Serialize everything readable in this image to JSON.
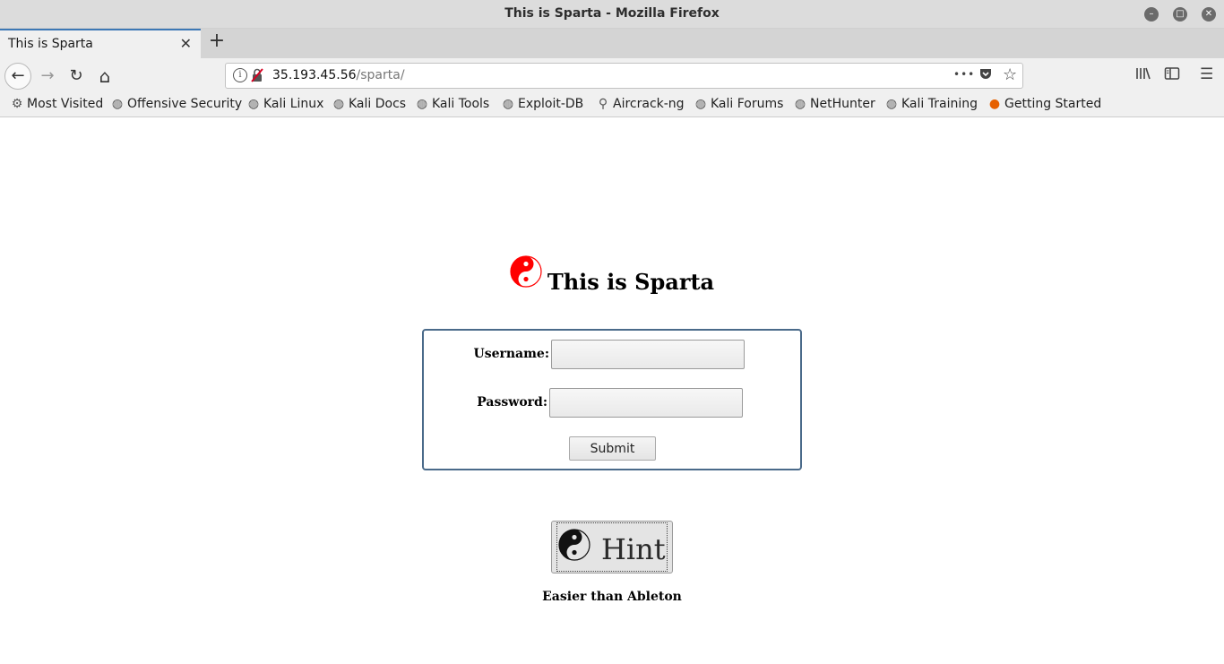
{
  "window": {
    "title": "This is Sparta - Mozilla Firefox"
  },
  "tab": {
    "title": "This is Sparta",
    "close_glyph": "✕",
    "new_tab_glyph": "+"
  },
  "navbar": {
    "back_glyph": "←",
    "forward_glyph": "→",
    "reload_glyph": "↻",
    "home_glyph": "⌂",
    "url_host": "35.193.45.56",
    "url_path": "/sparta/",
    "info_glyph": "i",
    "insecure_glyph": "🔒",
    "page_actions_glyph": "•••",
    "pocket_glyph": "◆",
    "star_glyph": "☆",
    "library_glyph": "𝄃\\",
    "sidebar_glyph": "▤",
    "menu_glyph": "☰"
  },
  "bookmarks": [
    {
      "label": "Most Visited",
      "icon": "gear-icon",
      "glyph": "⚙"
    },
    {
      "label": "Offensive Security",
      "icon": "globe-icon",
      "glyph": "🌐"
    },
    {
      "label": "Kali Linux",
      "icon": "globe-icon",
      "glyph": "🌐"
    },
    {
      "label": "Kali Docs",
      "icon": "globe-icon",
      "glyph": "🌐"
    },
    {
      "label": "Kali Tools",
      "icon": "globe-icon",
      "glyph": "🌐"
    },
    {
      "label": "Exploit-DB",
      "icon": "globe-icon",
      "glyph": "🌐"
    },
    {
      "label": "Aircrack-ng",
      "icon": "antenna-icon",
      "glyph": "📡"
    },
    {
      "label": "Kali Forums",
      "icon": "globe-icon",
      "glyph": "🌐"
    },
    {
      "label": "NetHunter",
      "icon": "globe-icon",
      "glyph": "🌐"
    },
    {
      "label": "Kali Training",
      "icon": "globe-icon",
      "glyph": "🌐"
    },
    {
      "label": "Getting Started",
      "icon": "firefox-icon",
      "glyph": "🦊"
    }
  ],
  "page": {
    "heading": "This is Sparta",
    "username_label": "Username:",
    "username_value": "",
    "password_label": "Password:",
    "password_value": "",
    "submit_label": "Submit",
    "hint_label": "Hint",
    "hint_caption": "Easier than Ableton",
    "accent_color": "#ff0000"
  }
}
